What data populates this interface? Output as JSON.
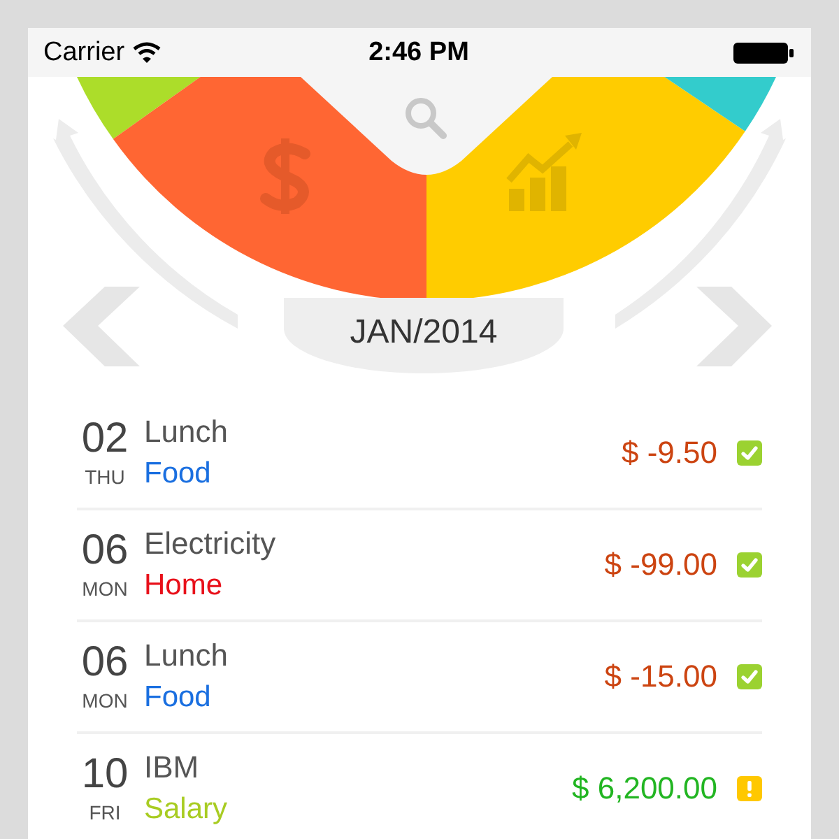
{
  "status_bar": {
    "carrier": "Carrier",
    "time": "2:46 PM"
  },
  "month": "JAN/2014",
  "transactions": [
    {
      "day": "02",
      "weekday": "THU",
      "title": "Lunch",
      "category": "Food",
      "color": "#1a6fe0",
      "amount": "$ -9.50",
      "kind": "expense",
      "cleared": true
    },
    {
      "day": "06",
      "weekday": "MON",
      "title": "Electricity",
      "category": "Home",
      "color": "#e8101a",
      "amount": "$ -99.00",
      "kind": "expense",
      "cleared": true
    },
    {
      "day": "06",
      "weekday": "MON",
      "title": "Lunch",
      "category": "Food",
      "color": "#1a6fe0",
      "amount": "$ -15.00",
      "kind": "expense",
      "cleared": true
    },
    {
      "day": "10",
      "weekday": "FRI",
      "title": "IBM",
      "category": "Salary",
      "color": "#a8cc22",
      "amount": "$ 6,200.00",
      "kind": "income",
      "cleared": false
    }
  ]
}
